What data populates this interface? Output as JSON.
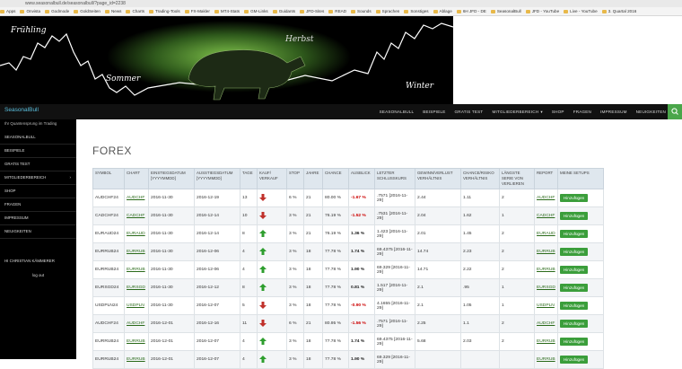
{
  "browser": {
    "url": "www.seasonalbull.de/seasonalbull/?page_id=2238",
    "bookmarks": [
      "Apps",
      "Onvista",
      "Godmode",
      "GoldSeiten",
      "News",
      "Charts",
      "Trading-Tools",
      "FX-Makler",
      "MT4-Stats",
      "GM-Links",
      "Guidants",
      "JFD-Sites",
      "READ",
      "Sounds",
      "Sprachen",
      "Sonstiges",
      "Ablage",
      "6H JFD - DE",
      "SeasonalBull",
      "JFD - YouTube",
      "Live - YouTube",
      "3. Quartal 2016"
    ]
  },
  "banner": {
    "label_spring": "Frühling",
    "label_summer": "Sommer",
    "label_autumn": "Herbst",
    "label_winter": "Winter"
  },
  "nav": {
    "brand": "SeasonalBull",
    "items": [
      "SEASONALBULL",
      "BEISPIELE",
      "GRATIS TEST",
      "MITGLIEDERBEREICH",
      "SHOP",
      "FRAGEN",
      "IMPRESSUM",
      "NEUIGKEITEN"
    ]
  },
  "sidebar": {
    "tagline": "Ihr Quantensprung im Trading",
    "items": [
      "SEASONALBULL",
      "BEISPIELE",
      "GRATIS TEST",
      "MITGLIEDERBEREICH",
      "SHOP",
      "FRAGEN",
      "IMPRESSUM",
      "NEUIGKEITEN"
    ],
    "user_greeting": "HI CHRISTIAN KÄMMERER",
    "logout": "log out"
  },
  "page": {
    "title": "FOREX",
    "columns": [
      "SYMBOL",
      "CHART",
      "EINSTIEGSDATUM [YYYYMMDD]",
      "AUSSTIEGSDATUM [YYYYMMDD]",
      "TAGE",
      "KAUF/ VERKAUF",
      "STOP",
      "JAHRE",
      "CHANCE",
      "AUSBLICK",
      "LETZTER SCHLUSSKURS",
      "GEWINN/VERLUST VERHÄLTNIS",
      "CHANCE/RISIKO VERHÄLTNIS",
      "LÄNGSTE SERIE VON VERLIEREN",
      "REPORT",
      "MEINE SETUPS"
    ],
    "add_label": "Hinzufügen",
    "rows": [
      {
        "symbol": "AUDCHF24",
        "chart": "AUDCHF",
        "entry": "2016-11-30",
        "exit": "2016-12-19",
        "days": "13",
        "dir": "down",
        "stop": "6 %",
        "years": "21",
        "chance": "80.00 %",
        "outlook": "-1.67 %",
        "last": ".7571 [2016-11-29]",
        "gv": "2.44",
        "cr": "1.11",
        "streak": "2",
        "report": "AUDCHF"
      },
      {
        "symbol": "CADCHF24",
        "chart": "CADCHF",
        "entry": "2016-11-30",
        "exit": "2016-12-14",
        "days": "10",
        "dir": "down",
        "stop": "3 %",
        "years": "21",
        "chance": "76.19 %",
        "outlook": "-1.52 %",
        "last": ".7531 [2016-11-29]",
        "gv": "2.04",
        "cr": "1.62",
        "streak": "1",
        "report": "CADCHF"
      },
      {
        "symbol": "EURAUD24",
        "chart": "EURAUD",
        "entry": "2016-11-30",
        "exit": "2016-12-14",
        "days": "8",
        "dir": "up",
        "stop": "3 %",
        "years": "21",
        "chance": "76.19 %",
        "outlook": "1.36 %",
        "last": "1.423 [2016-11-29]",
        "gv": "2.01",
        "cr": "1.45",
        "streak": "2",
        "report": "EURAUD"
      },
      {
        "symbol": "EURRUB24",
        "chart": "EURRUB",
        "entry": "2016-11-30",
        "exit": "2016-12-06",
        "days": "4",
        "dir": "up",
        "stop": "3 %",
        "years": "18",
        "chance": "77.78 %",
        "outlook": "1.74 %",
        "last": "69.4375 [2016-11-29]",
        "gv": "14.74",
        "cr": "2.23",
        "streak": "2",
        "report": "EURRUB"
      },
      {
        "symbol": "EURRUB24",
        "chart": "EURRUB",
        "entry": "2016-11-30",
        "exit": "2016-12-06",
        "days": "4",
        "dir": "up",
        "stop": "3 %",
        "years": "18",
        "chance": "77.78 %",
        "outlook": "1.90 %",
        "last": "69.329 [2016-11-29]",
        "gv": "14.71",
        "cr": "2.22",
        "streak": "2",
        "report": "EURRUB"
      },
      {
        "symbol": "EURSGD24",
        "chart": "EURSGD",
        "entry": "2016-11-30",
        "exit": "2016-12-12",
        "days": "8",
        "dir": "up",
        "stop": "3 %",
        "years": "18",
        "chance": "77.78 %",
        "outlook": "0.81 %",
        "last": "1.517 [2016-11-29]",
        "gv": "2.1",
        "cr": ".95",
        "streak": "1",
        "report": "EURSGD"
      },
      {
        "symbol": "USDPLN24",
        "chart": "USDPLN",
        "entry": "2016-11-30",
        "exit": "2016-12-07",
        "days": "5",
        "dir": "down",
        "stop": "3 %",
        "years": "18",
        "chance": "77.78 %",
        "outlook": "-0.90 %",
        "last": "4.1655 [2016-11-29]",
        "gv": "2.1",
        "cr": "1.05",
        "streak": "1",
        "report": "USDPLN"
      },
      {
        "symbol": "AUDCHF24",
        "chart": "AUDCHF",
        "entry": "2016-12-01",
        "exit": "2016-12-16",
        "days": "11",
        "dir": "down",
        "stop": "6 %",
        "years": "21",
        "chance": "80.95 %",
        "outlook": "-1.56 %",
        "last": ".7571 [2016-11-29]",
        "gv": "2.25",
        "cr": "1.1",
        "streak": "2",
        "report": "AUDCHF"
      },
      {
        "symbol": "EURRUB24",
        "chart": "EURRUB",
        "entry": "2016-12-01",
        "exit": "2016-12-07",
        "days": "4",
        "dir": "up",
        "stop": "3 %",
        "years": "18",
        "chance": "77.78 %",
        "outlook": "1.74 %",
        "last": "69.4375 [2016-11-29]",
        "gv": "5.68",
        "cr": "2.03",
        "streak": "2",
        "report": "EURRUB"
      },
      {
        "symbol": "EURRUB24",
        "chart": "EURRUB",
        "entry": "2016-12-01",
        "exit": "2016-12-07",
        "days": "4",
        "dir": "up",
        "stop": "3 %",
        "years": "18",
        "chance": "77.78 %",
        "outlook": "1.90 %",
        "last": "69.329 [2016-11-29]",
        "gv": "",
        "cr": "",
        "streak": "",
        "report": "EURRUB"
      }
    ]
  },
  "colors": {
    "accent_green": "#3b9e3b",
    "nav_bg": "#111111",
    "sidebar_bg": "#000000",
    "up_arrow": "#2e9e2e",
    "down_arrow": "#c0302a"
  }
}
